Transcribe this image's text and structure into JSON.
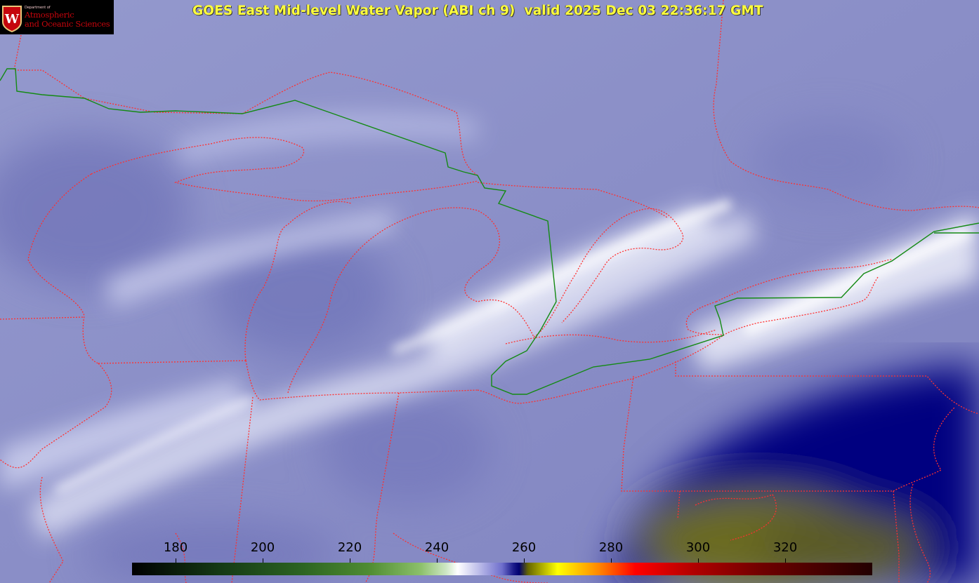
{
  "title": "GOES East Mid-level Water Vapor (ABI ch 9)  valid 2025 Dec 03 22:36:17 GMT",
  "logo": {
    "department": "Department of",
    "line1": "Atmospheric",
    "line2": "and Oceanic Sciences",
    "seal_letter": "W",
    "icon": "uw-crest-icon"
  },
  "colorbar": {
    "unit_range": [
      170,
      340
    ],
    "ticks": [
      {
        "value": 180,
        "label": "180"
      },
      {
        "value": 200,
        "label": "200"
      },
      {
        "value": 220,
        "label": "220"
      },
      {
        "value": 240,
        "label": "240"
      },
      {
        "value": 260,
        "label": "260"
      },
      {
        "value": 280,
        "label": "280"
      },
      {
        "value": 300,
        "label": "300"
      },
      {
        "value": 320,
        "label": "320"
      }
    ]
  },
  "colors": {
    "title": "#ffff3c",
    "state_boundary": "#ff3030",
    "country_boundary": "#138a13",
    "moisture": "#8f93c8",
    "dry_slot": "#000078"
  }
}
